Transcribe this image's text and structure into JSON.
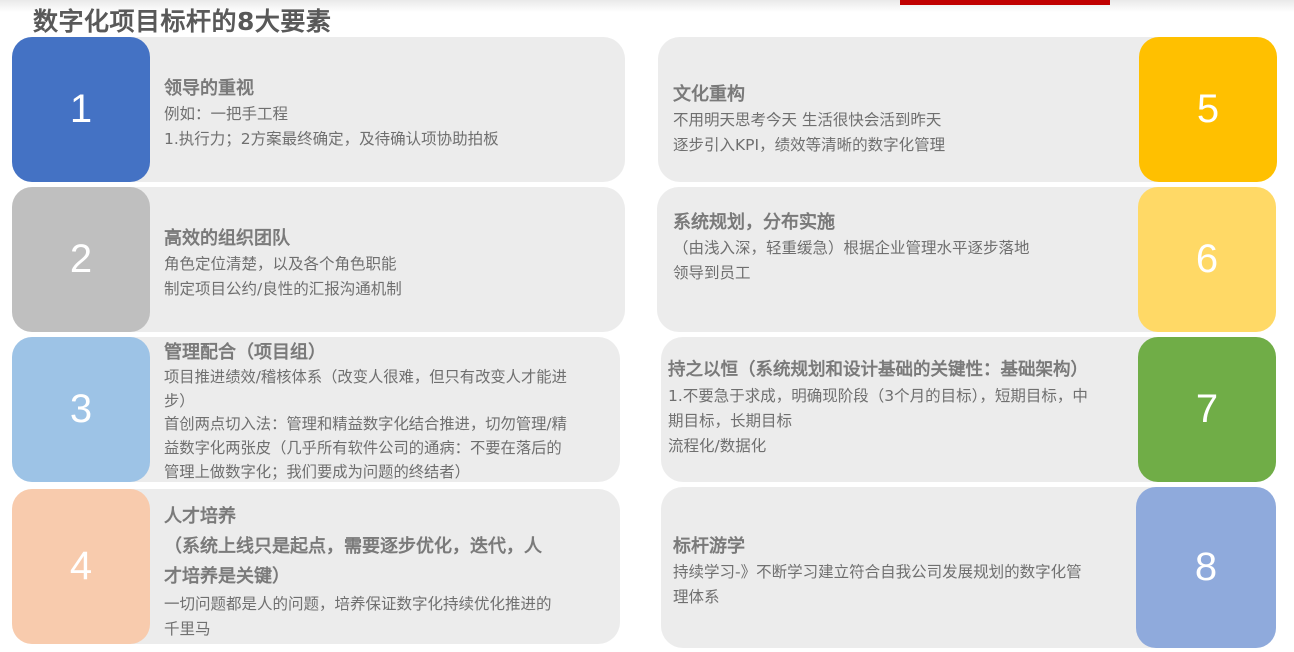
{
  "title": "数字化项目标杆的8大要素",
  "elements": [
    {
      "number": "1",
      "color": "#4472c4",
      "heading": "领导的重视",
      "lines": [
        "例如：一把手工程",
        "1.执行力；2方案最终确定，及待确认项协助拍板"
      ]
    },
    {
      "number": "2",
      "color": "#bfbfbf",
      "heading": "高效的组织团队",
      "lines": [
        "角色定位清楚，以及各个角色职能",
        "制定项目公约/良性的汇报沟通机制"
      ]
    },
    {
      "number": "3",
      "color": "#9dc3e6",
      "heading": "管理配合（项目组）",
      "lines": [
        "项目推进绩效/稽核体系（改变人很难，但只有改变人才能进",
        "步）",
        "首创两点切入法：管理和精益数字化结合推进，切勿管理/精",
        "益数字化两张皮（几乎所有软件公司的通病：不要在落后的",
        "管理上做数字化；我们要成为问题的终结者）"
      ]
    },
    {
      "number": "4",
      "color": "#f8cbad",
      "heading": "人才培养",
      "heading_lines": [
        "（系统上线只是起点，需要逐步优化，迭代，人",
        "才培养是关键）"
      ],
      "lines": [
        "一切问题都是人的问题，培养保证数字化持续优化推进的",
        "千里马"
      ]
    },
    {
      "number": "5",
      "color": "#ffc000",
      "heading": "文化重构",
      "lines": [
        "不用明天思考今天 生活很快会活到昨天",
        "逐步引入KPI，绩效等清晰的数字化管理"
      ]
    },
    {
      "number": "6",
      "color": "#ffd966",
      "heading": "系统规划，分布实施",
      "lines": [
        "（由浅入深，轻重缓急）根据企业管理水平逐步落地",
        "领导到员工"
      ]
    },
    {
      "number": "7",
      "color": "#70ad47",
      "heading": "持之以恒（系统规划和设计基础的关键性：基础架构）",
      "lines": [
        "1.不要急于求成，明确现阶段（3个月的目标），短期目标，中",
        "期目标，长期目标",
        "流程化/数据化"
      ]
    },
    {
      "number": "8",
      "color": "#8faadc",
      "heading": "标杆游学",
      "lines": [
        "持续学习-》不断学习建立符合自我公司发展规划的数字化管",
        "理体系"
      ]
    }
  ]
}
